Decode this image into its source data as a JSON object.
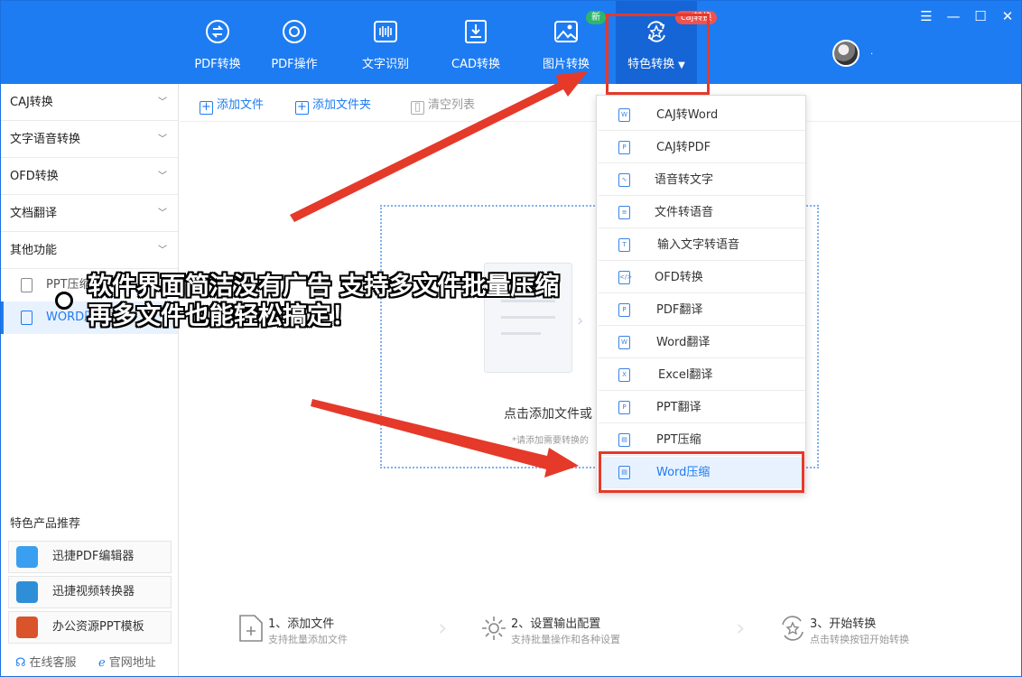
{
  "nav": [
    {
      "label": "PDF转换",
      "icon": "pdf-convert-icon"
    },
    {
      "label": "PDF操作",
      "icon": "pdf-operate-icon"
    },
    {
      "label": "文字识别",
      "icon": "text-recognition-icon"
    },
    {
      "label": "CAD转换",
      "icon": "cad-convert-icon"
    },
    {
      "label": "图片转换",
      "icon": "image-convert-icon"
    },
    {
      "label": "特色转换",
      "icon": "special-convert-icon"
    }
  ],
  "badges": {
    "new": "新",
    "caj": "caj转换"
  },
  "window": {
    "menu": "☰",
    "minimize": "—",
    "maximize": "☐",
    "close": "✕",
    "user_dot": "·"
  },
  "sidebar": {
    "categories": [
      "CAJ转换",
      "文字语音转换",
      "OFD转换",
      "文档翻译",
      "其他功能"
    ],
    "sub_items": [
      "PPT压缩",
      "WORD压缩"
    ],
    "recommend_title": "特色产品推荐",
    "recommend": [
      "迅捷PDF编辑器",
      "迅捷视频转换器",
      "办公资源PPT模板"
    ],
    "footer": [
      "在线客服",
      "官网地址"
    ]
  },
  "toolbar": {
    "add_file": "添加文件",
    "add_folder": "添加文件夹",
    "clear_list": "清空列表"
  },
  "dropzone": {
    "text": "点击添加文件或",
    "hint": "*请添加需要转换的"
  },
  "steps": [
    {
      "title": "1、添加文件",
      "desc": "支持批量添加文件"
    },
    {
      "title": "2、设置输出配置",
      "desc": "支持批量操作和各种设置"
    },
    {
      "title": "3、开始转换",
      "desc": "点击转换按钮开始转换"
    }
  ],
  "dropdown": [
    "CAJ转Word",
    "CAJ转PDF",
    "语音转文字",
    "文件转语音",
    "输入文字转语音",
    "OFD转换",
    "PDF翻译",
    "Word翻译",
    "Excel翻译",
    "PPT翻译",
    "PPT压缩",
    "Word压缩"
  ],
  "overlay": {
    "caption": "软件界面简洁没有广告 支持多文件批量压缩 再多文件也能轻松搞定！"
  },
  "colors": {
    "brand": "#1e7cf2",
    "annotation": "#e5392a"
  }
}
